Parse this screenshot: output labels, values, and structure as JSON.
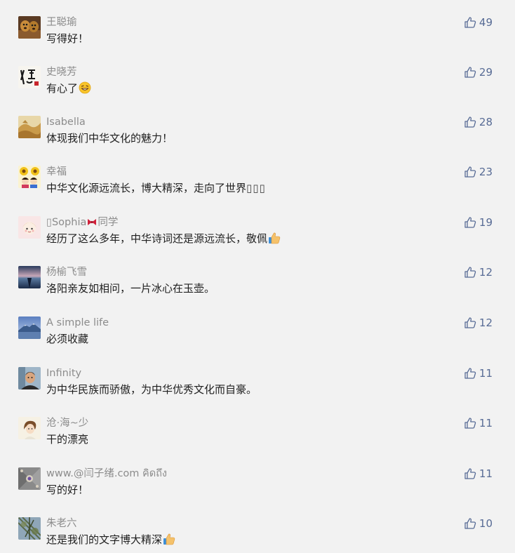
{
  "comments": [
    {
      "author": "王聪瑜",
      "content": "写得好！",
      "likes": "49",
      "avatar_icon": "dogs-avatar-icon"
    },
    {
      "author": "史晓芳",
      "content": "有心了",
      "content_emoji": "grinning-emoji-icon",
      "likes": "29",
      "avatar_icon": "calligraphy-avatar-icon"
    },
    {
      "author": "Isabella",
      "content": "体现我们中华文化的魅力！",
      "likes": "28",
      "avatar_icon": "desert-avatar-icon"
    },
    {
      "author": "幸福",
      "content": "中华文化源远流长，博大精深，走向了世界",
      "content_suffix": "▯▯▯",
      "likes": "23",
      "avatar_icon": "sunflower-avatar-icon"
    },
    {
      "author_prefix": "▯Sophia",
      "author_suffix": "同学",
      "content": "经历了这么多年，中华诗词还是源远流长，敬佩",
      "content_emoji": "thumbs-up-emoji-icon",
      "likes": "19",
      "avatar_icon": "cartoon-girl-avatar-icon"
    },
    {
      "author": "杨榆飞雪",
      "content": "洛阳亲友如相问，一片冰心在玉壶。",
      "likes": "12",
      "avatar_icon": "lake-avatar-icon"
    },
    {
      "author": "A simple life",
      "content": "必须收藏",
      "likes": "12",
      "avatar_icon": "mountain-avatar-icon"
    },
    {
      "author": "Infinity",
      "content": "为中华民族而骄傲，为中华优秀文化而自豪。",
      "likes": "11",
      "avatar_icon": "man-avatar-icon"
    },
    {
      "author": "沧·海~少",
      "content": "干的漂亮",
      "likes": "11",
      "avatar_icon": "girl-sketch-avatar-icon"
    },
    {
      "author": "www.@闫子绪.com คิดถึง",
      "content": "写的好！",
      "likes": "11",
      "avatar_icon": "pattern-avatar-icon"
    },
    {
      "author": "朱老六",
      "content": "还是我们的文字博大精深",
      "content_emoji": "thumbs-up-emoji-icon",
      "likes": "10",
      "avatar_icon": "tree-avatar-icon"
    }
  ]
}
